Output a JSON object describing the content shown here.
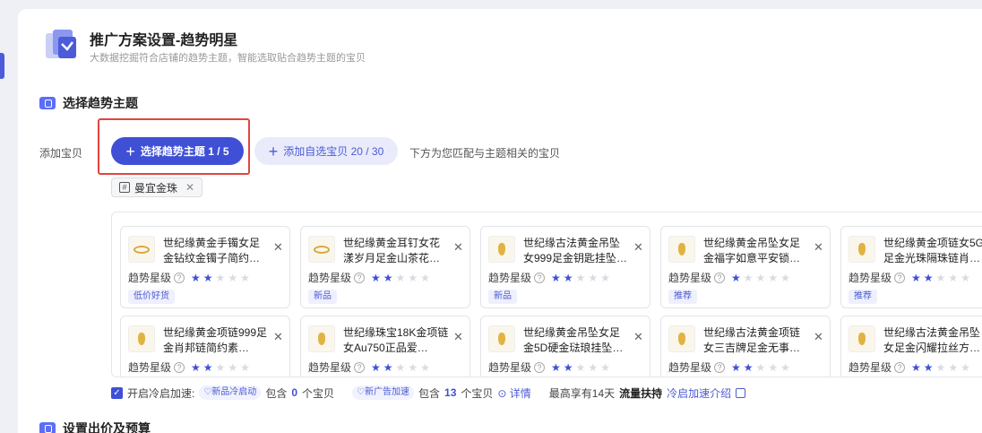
{
  "header": {
    "title": "推广方案设置-趋势明星",
    "subtitle": "大数据挖掘符合店铺的趋势主题，智能选取贴合趋势主题的宝贝"
  },
  "sections": {
    "select_theme": "选择趋势主题",
    "bid_budget": "设置出价及预算"
  },
  "add_items": {
    "label": "添加宝贝",
    "theme_button": "选择趋势主题 1 / 5",
    "custom_button": "添加自选宝贝 20 / 30",
    "hint": "下方为您匹配与主题相关的宝贝"
  },
  "theme_tag": {
    "label": "曼宜金珠"
  },
  "rating_label": "趋势星级",
  "colors": {
    "primary": "#3f50d6",
    "highlight": "#e0463f",
    "star_off": "#d9dbe2"
  },
  "products": [
    {
      "name": "世纪缘黄金手镯女足金钻纹金镯子简约…",
      "stars": 2,
      "badge": "低价好货",
      "icon": "bangle"
    },
    {
      "name": "世纪缘黄金耳钉女花漾岁月足金山茶花…",
      "stars": 2,
      "badge": "新品",
      "icon": "earring"
    },
    {
      "name": "世纪缘古法黄金吊坠女999足金钥匙挂坠…",
      "stars": 2,
      "badge": "新品",
      "icon": "pendant"
    },
    {
      "name": "世纪缘黄金吊坠女足金福字如意平安锁…",
      "stars": 1,
      "badge": "推荐",
      "icon": "pendant"
    },
    {
      "name": "世纪缘黄金项链女5G足金光珠隔珠链肖…",
      "stars": 2,
      "badge": "推荐",
      "icon": "necklace"
    },
    {
      "name": "世纪缘黄金项链999足金肖邦链简约素…",
      "stars": 2,
      "badge": "",
      "icon": "necklace"
    },
    {
      "name": "世纪缘珠宝18K金项链女Au750正品爱…",
      "stars": 2,
      "badge": "",
      "icon": "necklace"
    },
    {
      "name": "世纪缘黄金吊坠女足金5D硬金琺琅挂坠…",
      "stars": 2,
      "badge": "",
      "icon": "pendant"
    },
    {
      "name": "世纪缘古法黄金项链女三吉牌足金无事…",
      "stars": 2,
      "badge": "",
      "icon": "pendant"
    },
    {
      "name": "世纪缘古法黄金吊坠女足金闪耀拉丝方…",
      "stars": 2,
      "badge": "",
      "icon": "pendant"
    }
  ],
  "footer": {
    "checkbox_label": "开启冷启加速:",
    "pill1": "♡新品冷启动",
    "contains": "包含",
    "count1": "0",
    "unit": "个宝贝",
    "pill2": "♡新广告加速",
    "count2": "13",
    "detail": "详情",
    "max_text": "最高享有14天",
    "flow": "流量扶持",
    "intro_link": "冷启加速介绍"
  }
}
